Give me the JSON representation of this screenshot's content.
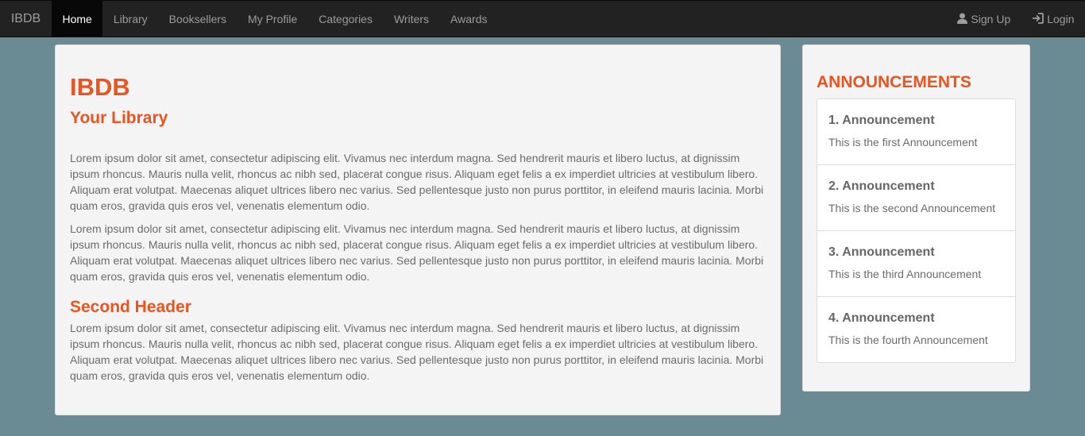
{
  "navbar": {
    "brand": "IBDB",
    "items": [
      {
        "label": "Home"
      },
      {
        "label": "Library"
      },
      {
        "label": "Booksellers"
      },
      {
        "label": "My Profile"
      },
      {
        "label": "Categories"
      },
      {
        "label": "Writers"
      },
      {
        "label": "Awards"
      }
    ],
    "signup_label": "Sign Up",
    "login_label": "Login",
    "signup_icon": "user-icon",
    "login_icon": "login-icon"
  },
  "main": {
    "title": "IBDB",
    "subtitle": "Your Library",
    "paragraph1": "Lorem ipsum dolor sit amet, consectetur adipiscing elit. Vivamus nec interdum magna. Sed hendrerit mauris et libero luctus, at dignissim ipsum rhoncus. Mauris nulla velit, rhoncus ac nibh sed, placerat congue risus. Aliquam eget felis a ex imperdiet ultricies at vestibulum libero. Aliquam erat volutpat. Maecenas aliquet ultrices libero nec varius. Sed pellentesque justo non purus porttitor, in eleifend mauris lacinia. Morbi quam eros, gravida quis eros vel, venenatis elementum odio.",
    "paragraph2": "Lorem ipsum dolor sit amet, consectetur adipiscing elit. Vivamus nec interdum magna. Sed hendrerit mauris et libero luctus, at dignissim ipsum rhoncus. Mauris nulla velit, rhoncus ac nibh sed, placerat congue risus. Aliquam eget felis a ex imperdiet ultricies at vestibulum libero. Aliquam erat volutpat. Maecenas aliquet ultrices libero nec varius. Sed pellentesque justo non purus porttitor, in eleifend mauris lacinia. Morbi quam eros, gravida quis eros vel, venenatis elementum odio.",
    "second_header": "Second Header",
    "paragraph3": "Lorem ipsum dolor sit amet, consectetur adipiscing elit. Vivamus nec interdum magna. Sed hendrerit mauris et libero luctus, at dignissim ipsum rhoncus. Mauris nulla velit, rhoncus ac nibh sed, placerat congue risus. Aliquam eget felis a ex imperdiet ultricies at vestibulum libero. Aliquam erat volutpat. Maecenas aliquet ultrices libero nec varius. Sed pellentesque justo non purus porttitor, in eleifend mauris lacinia. Morbi quam eros, gravida quis eros vel, venenatis elementum odio."
  },
  "sidebar": {
    "title": "ANNOUNCEMENTS",
    "announcements": [
      {
        "title": "1. Announcement",
        "text": "This is the first Announcement"
      },
      {
        "title": "2. Announcement",
        "text": "This is the second Announcement"
      },
      {
        "title": "3. Announcement",
        "text": "This is the third Announcement"
      },
      {
        "title": "4. Announcement",
        "text": "This is the fourth Announcement"
      }
    ]
  },
  "colors": {
    "accent": "#e95420",
    "navbar_bg": "#222222",
    "page_bg": "#6a8a94"
  }
}
